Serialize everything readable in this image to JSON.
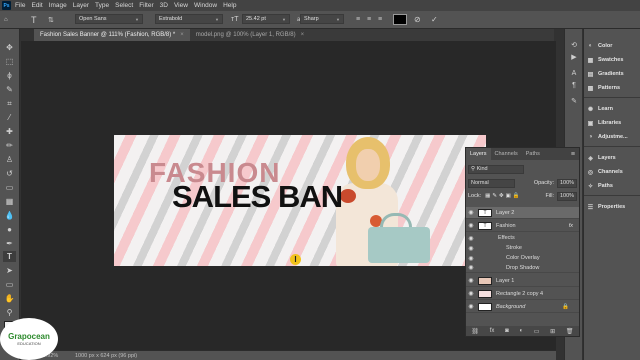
{
  "menubar": {
    "app_icon": "Ps",
    "items": [
      "File",
      "Edit",
      "Image",
      "Layer",
      "Type",
      "Select",
      "Filter",
      "3D",
      "View",
      "Window",
      "Help"
    ]
  },
  "options_bar": {
    "font_family": "Open Sans",
    "font_style": "Extrabold",
    "font_size": "25.42 pt",
    "antialias": "Sharp",
    "text_color": "#000000"
  },
  "tabs": [
    {
      "label": "Fashion Sales Banner @ 111% (Fashion, RGB/8) *",
      "active": true
    },
    {
      "label": "model.png @ 100% (Layer 1, RGB/8)",
      "active": false
    }
  ],
  "document": {
    "headline_1": "FASHION",
    "headline_2": "SALES BAN",
    "colors": {
      "stripe_pink": "#f6c9cc",
      "headline_1": "#c98a8f",
      "headline_2": "#111111"
    }
  },
  "status": {
    "zoom": "110.92%",
    "doc_size": "1000 px x 624 px (96 ppi)"
  },
  "right_panel": {
    "group1": [
      "Color",
      "Swatches",
      "Gradients",
      "Patterns"
    ],
    "group2": [
      "Learn",
      "Libraries",
      "Adjustme..."
    ],
    "group3": [
      "Layers",
      "Channels",
      "Paths"
    ],
    "group4": [
      "Properties"
    ]
  },
  "layers_panel": {
    "tabs": [
      "Layers",
      "Channels",
      "Paths"
    ],
    "search_placeholder": "Kind",
    "blend_mode": "Normal",
    "opacity_label": "Opacity:",
    "opacity_value": "100%",
    "lock_label": "Lock:",
    "fill_label": "Fill:",
    "fill_value": "100%",
    "layers": [
      {
        "name": "Layer 2",
        "thumb": "T",
        "selected": true
      },
      {
        "name": "Fashion",
        "thumb": "T",
        "fx": "fx"
      },
      {
        "name": "Effects",
        "sub": true
      },
      {
        "name": "Stroke",
        "sub": true
      },
      {
        "name": "Color Overlay",
        "sub": true
      },
      {
        "name": "Drop Shadow",
        "sub": true
      },
      {
        "name": "Layer 1",
        "thumb": ""
      },
      {
        "name": "Rectangle 2 copy 4",
        "thumb": ""
      },
      {
        "name": "Background",
        "thumb": ""
      }
    ]
  },
  "watermark": {
    "brand": "Grapocean",
    "sub": "EDUCATION"
  }
}
